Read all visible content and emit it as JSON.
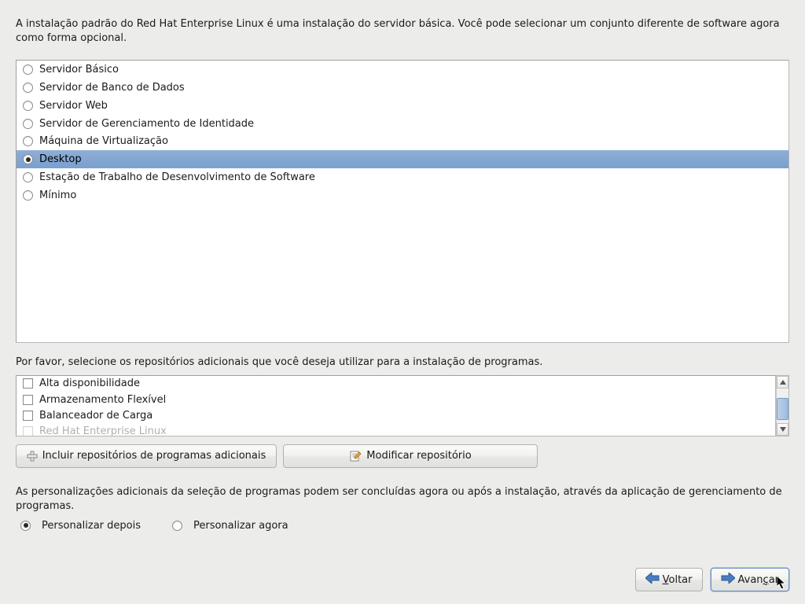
{
  "intro": "A instalação padrão do Red Hat Enterprise Linux é uma instalação do servidor básica. Você pode selecionar um conjunto diferente de software agora como forma opcional.",
  "software_options": [
    {
      "label": "Servidor Básico",
      "selected": false
    },
    {
      "label": "Servidor de Banco de Dados",
      "selected": false
    },
    {
      "label": "Servidor Web",
      "selected": false
    },
    {
      "label": "Servidor de Gerenciamento de Identidade",
      "selected": false
    },
    {
      "label": "Máquina de Virtualização",
      "selected": false
    },
    {
      "label": "Desktop",
      "selected": true
    },
    {
      "label": "Estação de Trabalho de Desenvolvimento de Software",
      "selected": false
    },
    {
      "label": "Mínimo",
      "selected": false
    }
  ],
  "repo_prompt": "Por favor, selecione os repositórios adicionais que você deseja utilizar para a instalação de programas.",
  "repo_items": [
    {
      "label": "Alta disponibilidade",
      "checked": false
    },
    {
      "label": "Armazenamento Flexível",
      "checked": false
    },
    {
      "label": "Balanceador de Carga",
      "checked": false
    },
    {
      "label": "Red Hat Enterprise Linux",
      "checked": false
    }
  ],
  "buttons": {
    "add_repo": "Incluir repositórios de programas adicionais",
    "modify_repo": "Modificar repositório"
  },
  "customize_text": "As personalizações adicionais da seleção de programas podem ser concluídas agora ou após a instalação, através da aplicação de gerenciamento de programas.",
  "customize_options": {
    "later": "Personalizar depois",
    "now": "Personalizar agora",
    "selected": "later"
  },
  "nav": {
    "back_label": "Voltar",
    "back_accel": "V",
    "next_label": "Avançar",
    "next_accel": "ç"
  }
}
